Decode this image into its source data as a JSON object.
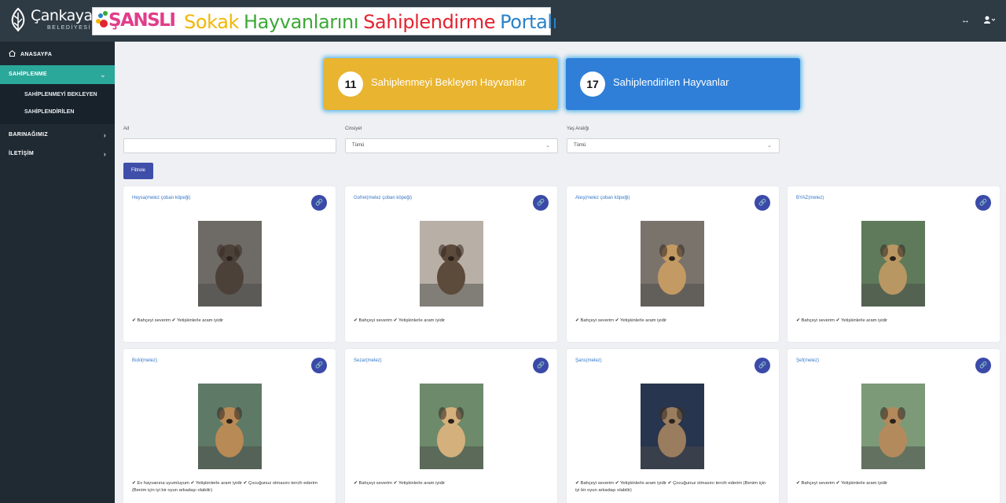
{
  "header": {
    "logo_name": "Çankaya",
    "logo_sub": "BELEDİYESİ",
    "brand": "ŞANSLI",
    "portal_words": [
      {
        "text": "Sokak",
        "color": "#f2b705"
      },
      {
        "text": "Hayvanlarını",
        "color": "#3aa935"
      },
      {
        "text": "Sahiplendirme",
        "color": "#e3232f"
      },
      {
        "text": "Portalı",
        "color": "#2a82c9"
      }
    ]
  },
  "sidebar": {
    "home": "ANASAYFA",
    "adoption": "SAHİPLENME",
    "sub_waiting": "SAHİPLENMEYİ BEKLEYEN",
    "sub_adopted": "SAHİPLENDİRİLEN",
    "shelter": "BARINAĞIMIZ",
    "contact": "İLETİŞİM"
  },
  "stats": {
    "waiting_count": "11",
    "waiting_label": "Sahiplenmeyi Bekleyen Hayvanlar",
    "adopted_count": "17",
    "adopted_label": "Sahiplendirilen Hayvanlar"
  },
  "filters": {
    "name_label": "Ad",
    "gender_label": "Cinsiyet",
    "gender_value": "Tümü",
    "age_label": "Yaş Aralığı",
    "age_value": "Tümü",
    "button": "Filtrele"
  },
  "colors": {
    "accent": "#2aa89a",
    "stat_yellow": "#e9b42f",
    "stat_blue": "#2f7fd8",
    "button": "#3f4ea8"
  },
  "cards": [
    {
      "name": "Heysa(melez çoban köpeği)",
      "traits": "✔ Bahçeyi severim ✔ Yetişkinlerle aram iyidir",
      "photo_bg": "#6e6a66",
      "photo_fg": "#4c4138"
    },
    {
      "name": "Gofret(melez çoban köpeği)",
      "traits": "✔ Bahçeyi severim ✔ Yetişkinlerle aram iyidir",
      "photo_bg": "#b8b0a6",
      "photo_fg": "#5c4a3a"
    },
    {
      "name": "Ateş(melez çoban köpeği)",
      "traits": "✔ Bahçeyi severim ✔ Yetişkinlerle aram iyidir",
      "photo_bg": "#7a736c",
      "photo_fg": "#c39a63"
    },
    {
      "name": "BYAZ(melez)",
      "traits": "✔ Bahçeyi severim ✔ Yetişkinlerle aram iyidir",
      "photo_bg": "#5f7a5a",
      "photo_fg": "#b89763"
    },
    {
      "name": "Bıdıl(melez)",
      "traits": "✔ Ev hayvanına uyumluyum ✔ Yetişkinlerle aram iyidir ✔ Çocuğunuz olmasını tercih ederim (Benim için iyi bir oyun arkadaşı olabilir)",
      "photo_bg": "#5e7a66",
      "photo_fg": "#b88a55"
    },
    {
      "name": "Sezar(melez)",
      "traits": "✔ Bahçeyi severim ✔ Yetişkinlerle aram iyidir",
      "photo_bg": "#6d8a6a",
      "photo_fg": "#d4b07c"
    },
    {
      "name": "Şans(melez)",
      "traits": "✔ Bahçeyi severim ✔ Yetişkinlerle aram iyidir ✔ Çocuğunuz olmasını tercih ederim (Benim için iyi bir oyun arkadaşı olabilir)",
      "photo_bg": "#28354e",
      "photo_fg": "#9a7d5e"
    },
    {
      "name": "Şef(melez)",
      "traits": "✔ Bahçeyi severim ✔ Yetişkinlerle aram iyidir",
      "photo_bg": "#7c9a78",
      "photo_fg": "#b38a5c"
    }
  ]
}
